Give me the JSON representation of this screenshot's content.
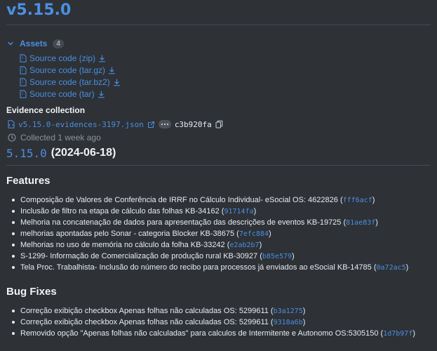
{
  "release": {
    "title": "v5.15.0"
  },
  "assets": {
    "label": "Assets",
    "count": "4",
    "items": [
      {
        "label": "Source code (zip)"
      },
      {
        "label": "Source code (tar.gz)"
      },
      {
        "label": "Source code (tar.bz2)"
      },
      {
        "label": "Source code (tar)"
      }
    ]
  },
  "evidence": {
    "heading": "Evidence collection",
    "file": "v5.15.0-evidences-3197.json",
    "sha": "c3b920fa",
    "collected": "Collected 1 week ago"
  },
  "changelog": {
    "version": "5.15.0",
    "date": "(2024-06-18)"
  },
  "features": {
    "heading": "Features",
    "items": [
      {
        "text": "Composição de Valores de Conferência de IRRF no Cálculo Individual- eSocial OS: 4622826 (",
        "hash": "fff6acf",
        "close": ")"
      },
      {
        "text": "Inclusão de filtro na etapa de cálculo das folhas KB-34162 (",
        "hash": "91714fa",
        "close": ")"
      },
      {
        "text": "Melhoria na concatenação de dados para apresentação das descrições de eventos KB-19725 (",
        "hash": "81ae83f",
        "close": ")"
      },
      {
        "text": "melhorias apontadas pelo Sonar - categoria Blocker KB-38675 (",
        "hash": "7efc884",
        "close": ")"
      },
      {
        "text": "Melhorias no uso de memória no cálculo da folha KB-33242 (",
        "hash": "e2ab2b7",
        "close": ")"
      },
      {
        "text": "S-1299- Informação de Comercialização de produção rural KB-30927 (",
        "hash": "b85e579",
        "close": ")"
      },
      {
        "text": "Tela Proc. Trabalhista- Inclusão do número do recibo para processos já enviados ao eSocial KB-14785 (",
        "hash": "0a72ac5",
        "close": ")"
      }
    ]
  },
  "bugfixes": {
    "heading": "Bug Fixes",
    "items": [
      {
        "text": "Correção exibição checkbox Apenas folhas não calculadas OS: 5299611 (",
        "hash": "b3a1275",
        "close": ")"
      },
      {
        "text": "Correção exibição checkbox Apenas folhas não calculadas OS: 5299611 (",
        "hash": "9318a6b",
        "close": ")"
      },
      {
        "text": "Removido opção \"Apenas folhas não calculadas\" para calculos de Intermitente e Autonomo OS:5305150 (",
        "hash": "1d7b97f",
        "close": ")"
      }
    ]
  },
  "colors": {
    "link": "#4a90e2",
    "background": "#2e3136",
    "text": "#e6edf3",
    "muted": "#8b949e"
  },
  "icons": [
    "chevron-down-icon",
    "file-zip-icon",
    "download-icon",
    "file-code-icon",
    "external-link-icon",
    "copy-icon",
    "clock-icon"
  ]
}
